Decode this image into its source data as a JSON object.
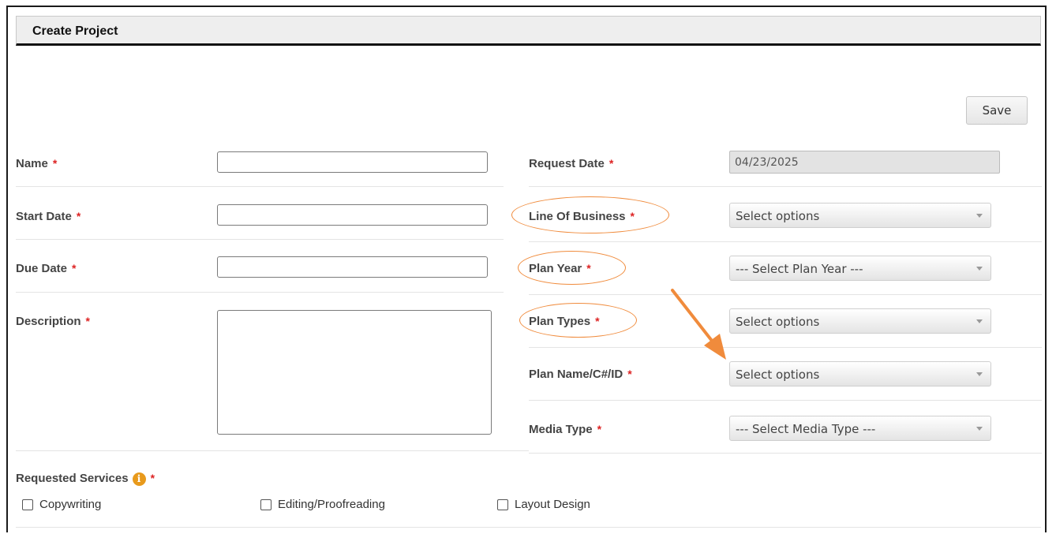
{
  "header": {
    "title": "Create Project"
  },
  "toolbar": {
    "save_label": "Save"
  },
  "required_marker": "*",
  "form": {
    "name": {
      "label": "Name",
      "value": ""
    },
    "start_date": {
      "label": "Start Date",
      "value": ""
    },
    "due_date": {
      "label": "Due Date",
      "value": ""
    },
    "description": {
      "label": "Description",
      "value": ""
    },
    "request_date": {
      "label": "Request Date",
      "value": "04/23/2025"
    },
    "line_of_business": {
      "label": "Line Of Business",
      "selected": "Select options"
    },
    "plan_year": {
      "label": "Plan Year",
      "selected": "--- Select Plan Year ---"
    },
    "plan_types": {
      "label": "Plan Types",
      "selected": "Select options"
    },
    "plan_name": {
      "label": "Plan Name/C#/ID",
      "selected": "Select options"
    },
    "media_type": {
      "label": "Media Type",
      "selected": "--- Select Media Type ---"
    }
  },
  "services": {
    "label": "Requested Services",
    "info_glyph": "i",
    "options": [
      {
        "label": "Copywriting",
        "checked": false
      },
      {
        "label": "Editing/Proofreading",
        "checked": false
      },
      {
        "label": "Layout Design",
        "checked": false
      }
    ]
  },
  "icons": {
    "chevron": "chevron-down-icon",
    "info": "info-icon",
    "annotation_arrow": "arrow-icon"
  },
  "colors": {
    "annotation": "#f08b3c",
    "required": "#dd2222",
    "info_badge": "#e89a1c",
    "header_bg": "#eeeeee"
  }
}
